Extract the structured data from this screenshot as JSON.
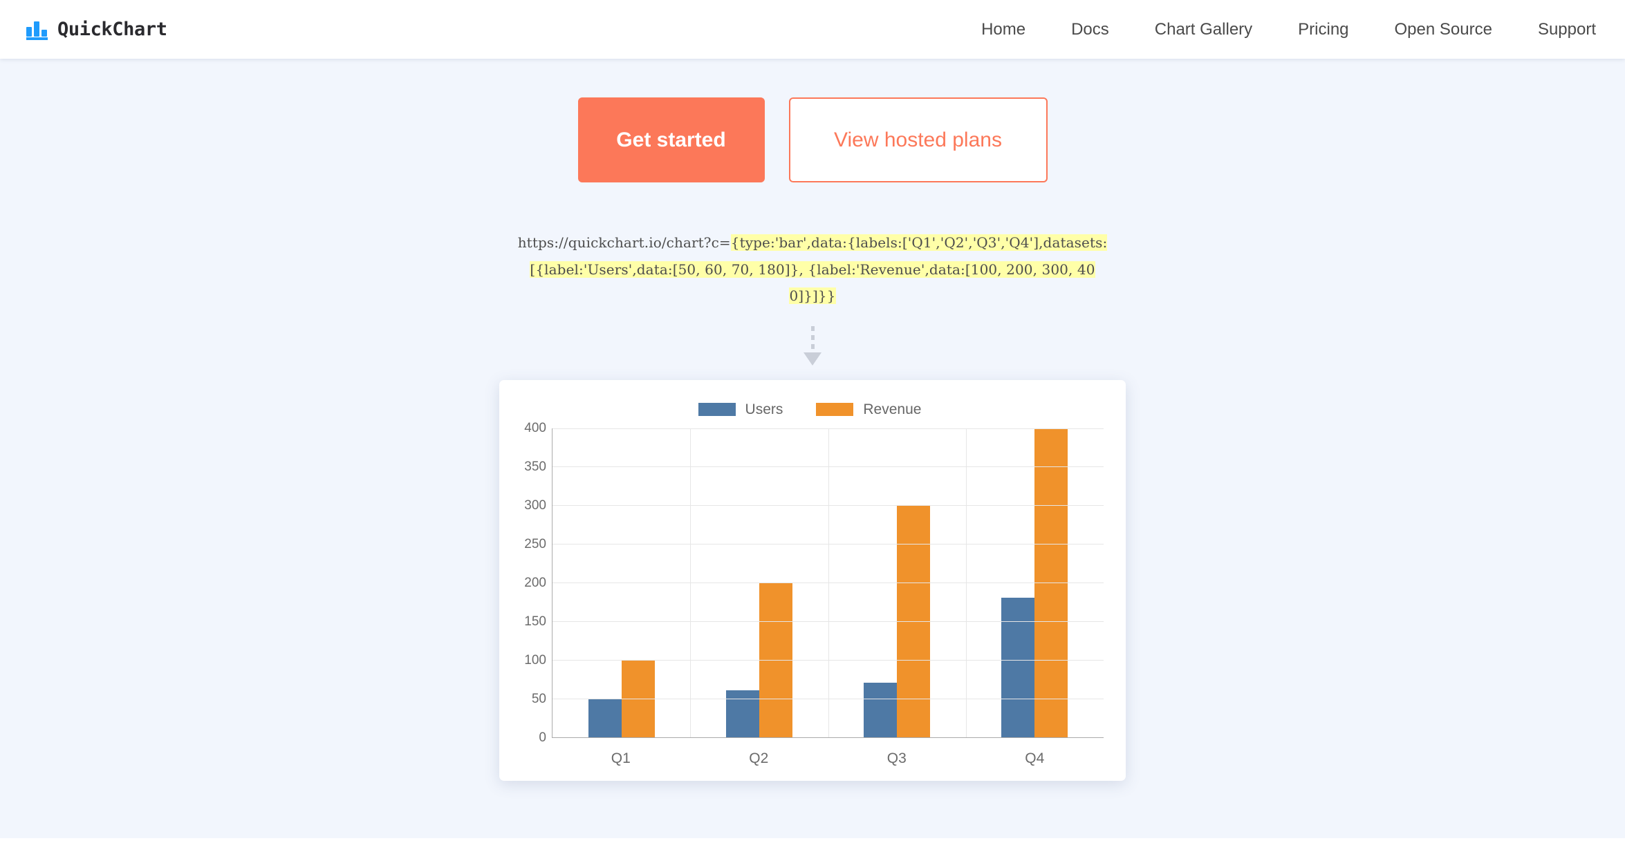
{
  "header": {
    "brand": {
      "name": "QuickChart",
      "logo_icon": "bar-chart-logo-icon",
      "logo_color": "#1f9bfc"
    },
    "nav": [
      {
        "label": "Home"
      },
      {
        "label": "Docs"
      },
      {
        "label": "Chart Gallery"
      },
      {
        "label": "Pricing"
      },
      {
        "label": "Open Source"
      },
      {
        "label": "Support"
      }
    ]
  },
  "hero": {
    "cta": {
      "primary_label": "Get started",
      "primary_bg": "#fc7859",
      "primary_text_color": "#ffffff",
      "secondary_label": "View hosted plans",
      "secondary_border": "#fc7859",
      "secondary_text_color": "#fc7859"
    },
    "url_example": {
      "prefix": "https://quickchart.io/chart?c=",
      "config": "{type:'bar',data:{labels:['Q1','Q2','Q3','Q4'],datasets:[{label:'Users',data:[50, 60, 70, 180]}, {label:'Revenue',data:[100, 200, 300, 400]}]}}",
      "highlight_color": "#ffffa8"
    },
    "arrow_icon": "dashed-down-arrow-icon"
  },
  "chart_data": {
    "type": "bar",
    "title": "",
    "xlabel": "",
    "ylabel": "",
    "categories": [
      "Q1",
      "Q2",
      "Q3",
      "Q4"
    ],
    "series": [
      {
        "name": "Users",
        "values": [
          50,
          60,
          70,
          180
        ],
        "color": "#4e79a5"
      },
      {
        "name": "Revenue",
        "values": [
          100,
          200,
          300,
          400
        ],
        "color": "#f0922b"
      }
    ],
    "ylim": [
      0,
      400
    ],
    "yticks": [
      400,
      350,
      300,
      250,
      200,
      150,
      100,
      50,
      0
    ],
    "grid": true,
    "legend_position": "top"
  }
}
